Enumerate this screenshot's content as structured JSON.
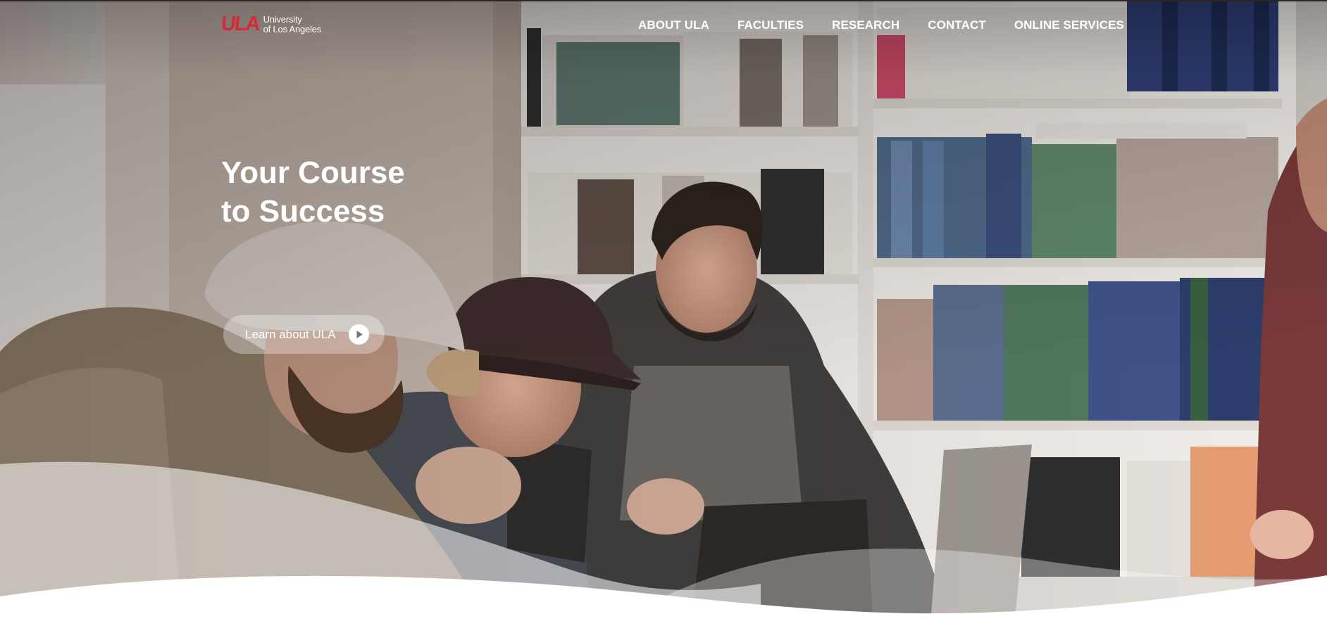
{
  "logo": {
    "mark": "ULA",
    "line1": "University",
    "line2": "of Los Angeles"
  },
  "nav": {
    "items": [
      {
        "label": "ABOUT ULA"
      },
      {
        "label": "FACULTIES"
      },
      {
        "label": "RESEARCH"
      },
      {
        "label": "CONTACT"
      },
      {
        "label": "ONLINE SERVICES"
      }
    ]
  },
  "hero": {
    "headline_line1": "Your Course",
    "headline_line2": "to Success",
    "cta_label": "Learn about ULA",
    "cta_icon": "play-circle-icon"
  },
  "colors": {
    "brand": "#d42a3a",
    "text": "#ffffff",
    "wave": "#ffffff"
  }
}
